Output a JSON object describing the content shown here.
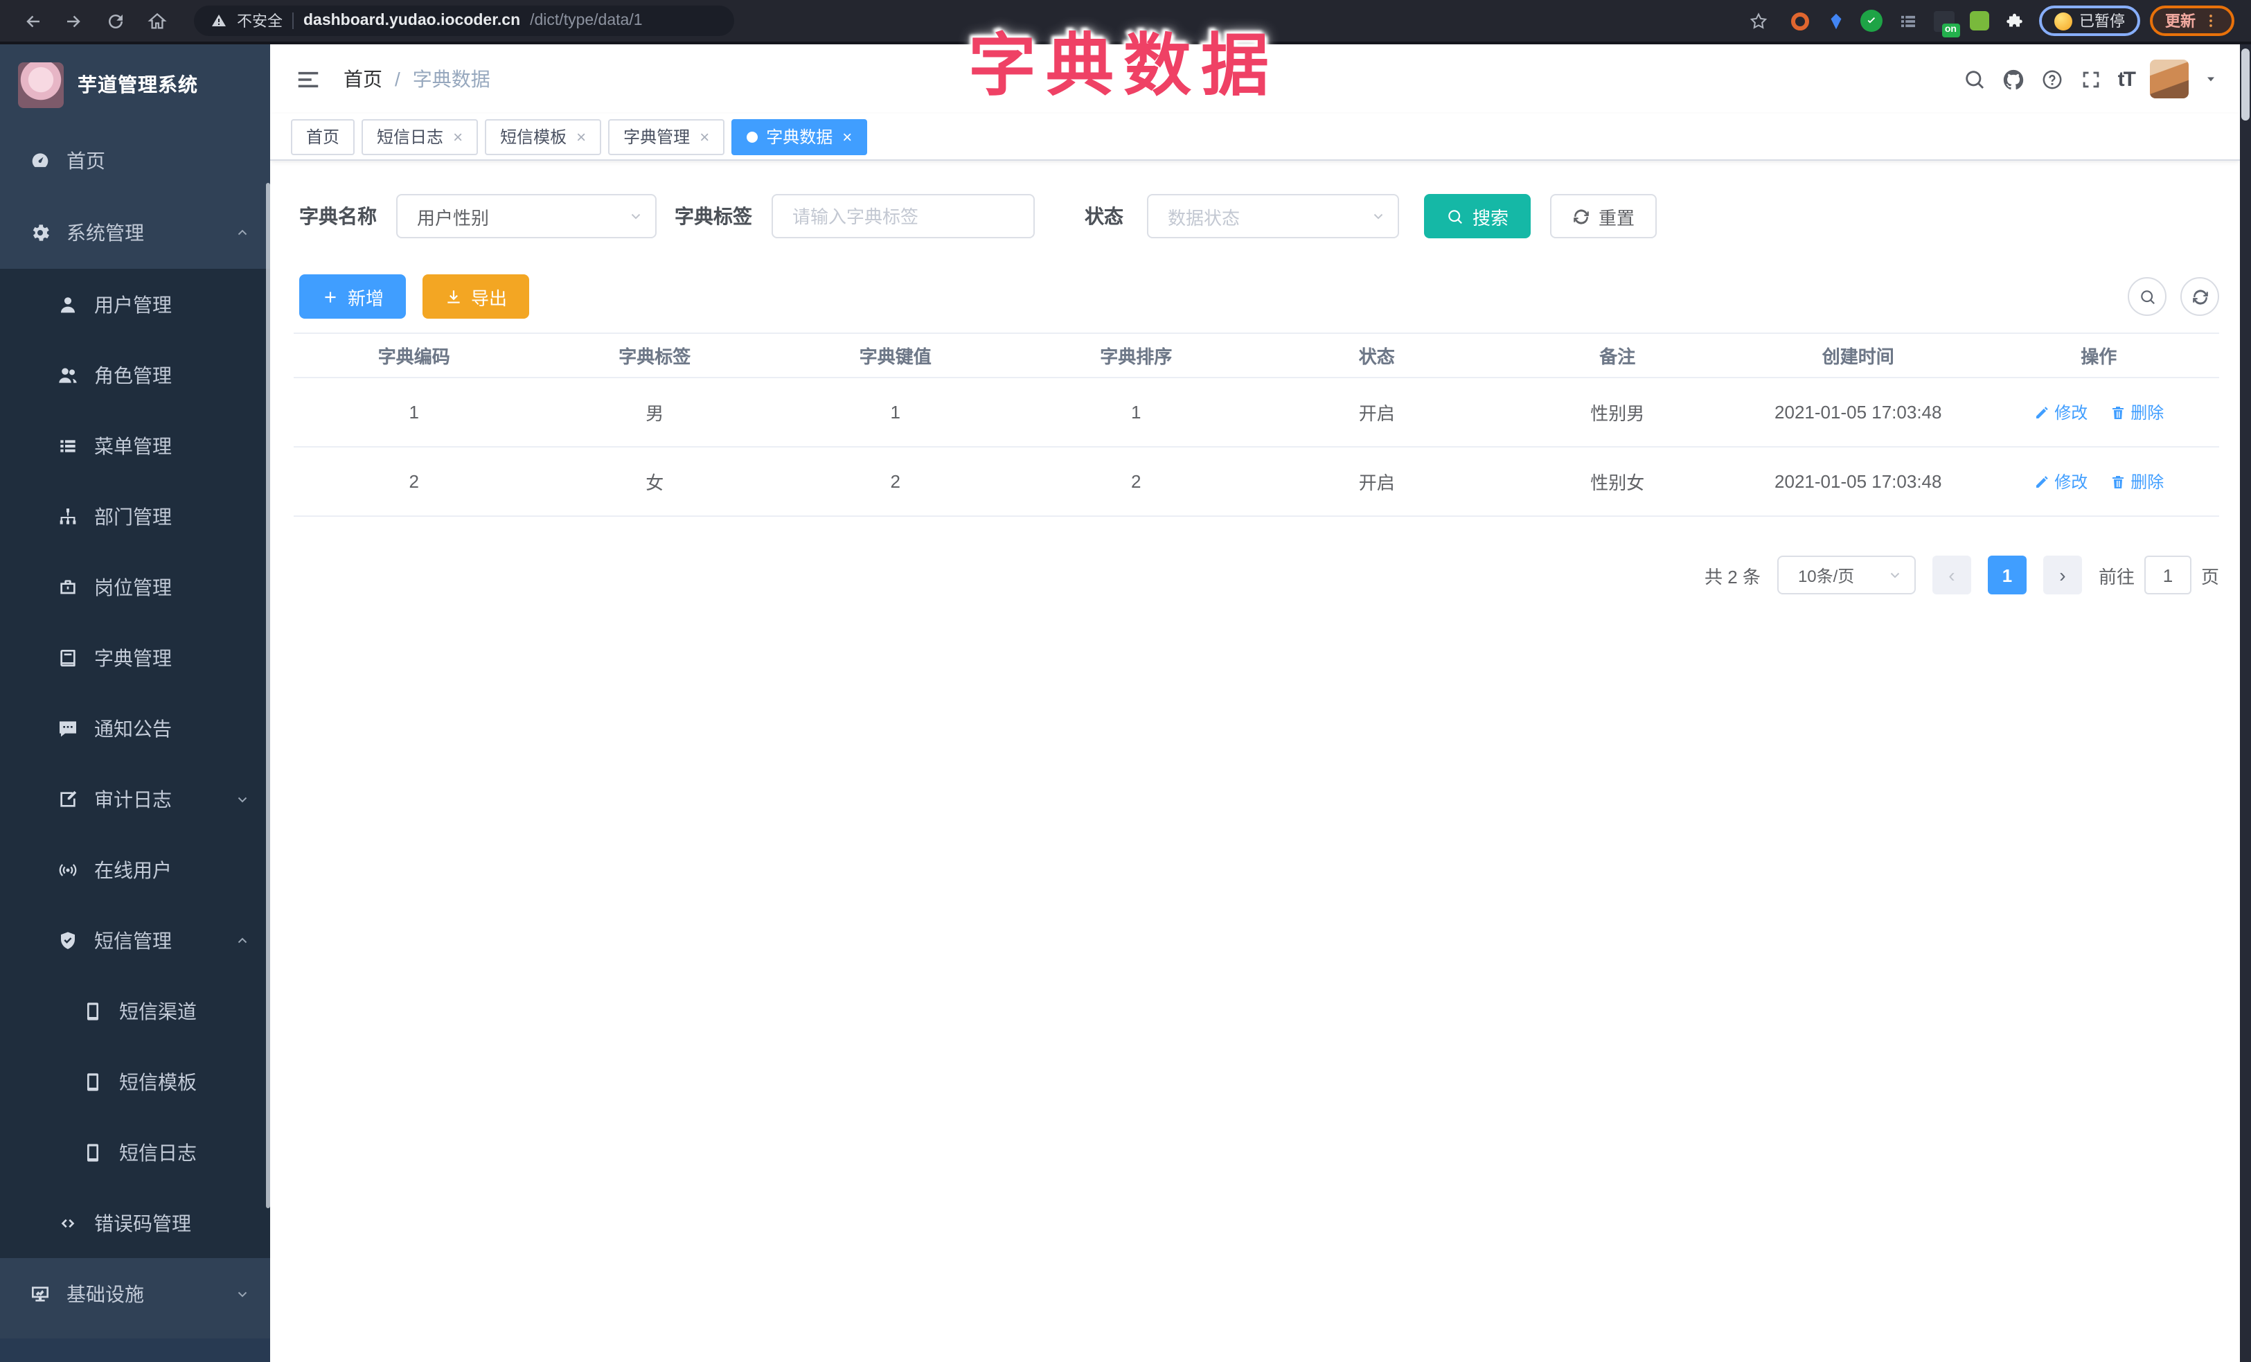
{
  "overlay_title": "字典数据",
  "browser": {
    "security_label": "不安全",
    "url_host": "dashboard.yudao.iocoder.cn",
    "url_path": "/dict/type/data/1",
    "paused_label": "已暂停",
    "update_label": "更新",
    "extensions": [
      {
        "name": "extension-ublock-icon",
        "shape": "ring",
        "color": "#e0662f"
      },
      {
        "name": "extension-gem-icon",
        "shape": "gem",
        "color": "#4285f4"
      },
      {
        "name": "extension-check-icon",
        "shape": "check-circle",
        "color": "#1ea446"
      },
      {
        "name": "extension-stats-icon",
        "shape": "bars",
        "color": "#8a93a5"
      },
      {
        "name": "extension-switch-icon",
        "shape": "on-badge",
        "color": "#2f333d",
        "badge": "on"
      },
      {
        "name": "extension-bot-icon",
        "shape": "square",
        "color": "#79b93c"
      },
      {
        "name": "extension-puzzle-icon",
        "shape": "puzzle",
        "color": "#f1f3f4"
      }
    ]
  },
  "sidebar": {
    "app_title": "芋道管理系统",
    "items": [
      {
        "label": "首页",
        "slug": "home",
        "level": 0,
        "icon": "dashboard-icon"
      },
      {
        "label": "系统管理",
        "slug": "system",
        "level": 0,
        "icon": "gear-icon",
        "chevron": "up"
      },
      {
        "label": "用户管理",
        "slug": "user",
        "level": 1,
        "icon": "user-icon"
      },
      {
        "label": "角色管理",
        "slug": "role",
        "level": 1,
        "icon": "users-icon"
      },
      {
        "label": "菜单管理",
        "slug": "menu",
        "level": 1,
        "icon": "menu-list-icon"
      },
      {
        "label": "部门管理",
        "slug": "dept",
        "level": 1,
        "icon": "org-tree-icon"
      },
      {
        "label": "岗位管理",
        "slug": "post",
        "level": 1,
        "icon": "briefcase-icon"
      },
      {
        "label": "字典管理",
        "slug": "dict",
        "level": 1,
        "icon": "book-icon"
      },
      {
        "label": "通知公告",
        "slug": "notice",
        "level": 1,
        "icon": "message-icon"
      },
      {
        "label": "审计日志",
        "slug": "audit-log",
        "level": 1,
        "icon": "log-icon",
        "chevron": "down"
      },
      {
        "label": "在线用户",
        "slug": "online-user",
        "level": 1,
        "icon": "online-icon"
      },
      {
        "label": "短信管理",
        "slug": "sms",
        "level": 1,
        "icon": "shield-icon",
        "chevron": "up"
      },
      {
        "label": "短信渠道",
        "slug": "sms-channel",
        "level": 2,
        "icon": "phone-icon"
      },
      {
        "label": "短信模板",
        "slug": "sms-template",
        "level": 2,
        "icon": "phone-icon"
      },
      {
        "label": "短信日志",
        "slug": "sms-log",
        "level": 2,
        "icon": "phone-icon"
      },
      {
        "label": "错误码管理",
        "slug": "error-code",
        "level": 1,
        "icon": "code-icon"
      },
      {
        "label": "基础设施",
        "slug": "infra",
        "level": 0,
        "icon": "monitor-icon",
        "chevron": "down"
      }
    ]
  },
  "navbar": {
    "breadcrumb": [
      "首页",
      "字典数据"
    ],
    "separator": "/"
  },
  "tabs": [
    {
      "label": "首页",
      "slug": "home",
      "closable": false,
      "active": false
    },
    {
      "label": "短信日志",
      "slug": "sms-log",
      "closable": true,
      "active": false
    },
    {
      "label": "短信模板",
      "slug": "sms-template",
      "closable": true,
      "active": false
    },
    {
      "label": "字典管理",
      "slug": "dict",
      "closable": true,
      "active": false
    },
    {
      "label": "字典数据",
      "slug": "dict-data",
      "closable": true,
      "active": true
    }
  ],
  "filters": {
    "dict_name": {
      "label": "字典名称",
      "value": "用户性别"
    },
    "dict_label": {
      "label": "字典标签",
      "placeholder": "请输入字典标签"
    },
    "status": {
      "label": "状态",
      "placeholder": "数据状态"
    },
    "search_label": "搜索",
    "reset_label": "重置"
  },
  "toolbar": {
    "add_label": "新增",
    "export_label": "导出"
  },
  "table": {
    "columns": [
      "字典编码",
      "字典标签",
      "字典键值",
      "字典排序",
      "状态",
      "备注",
      "创建时间",
      "操作"
    ],
    "rows": [
      {
        "code": "1",
        "label": "男",
        "value": "1",
        "sort": "1",
        "status": "开启",
        "remark": "性别男",
        "created": "2021-01-05 17:03:48"
      },
      {
        "code": "2",
        "label": "女",
        "value": "2",
        "sort": "2",
        "status": "开启",
        "remark": "性别女",
        "created": "2021-01-05 17:03:48"
      }
    ],
    "row_actions": [
      {
        "label": "修改",
        "icon": "edit-icon"
      },
      {
        "label": "删除",
        "icon": "trash-icon"
      }
    ]
  },
  "pagination": {
    "total": "共 2 条",
    "page_size": "10条/页",
    "current": "1",
    "goto_label": "前往",
    "goto_value": "1",
    "page_unit": "页"
  },
  "colors": {
    "primary": "#409eff",
    "search_teal": "#15b8a6",
    "export_orange": "#f3a623",
    "overlay_pink": "#ef4165",
    "sidebar_bg": "#304156",
    "submenu_bg": "#1f2d3d"
  }
}
